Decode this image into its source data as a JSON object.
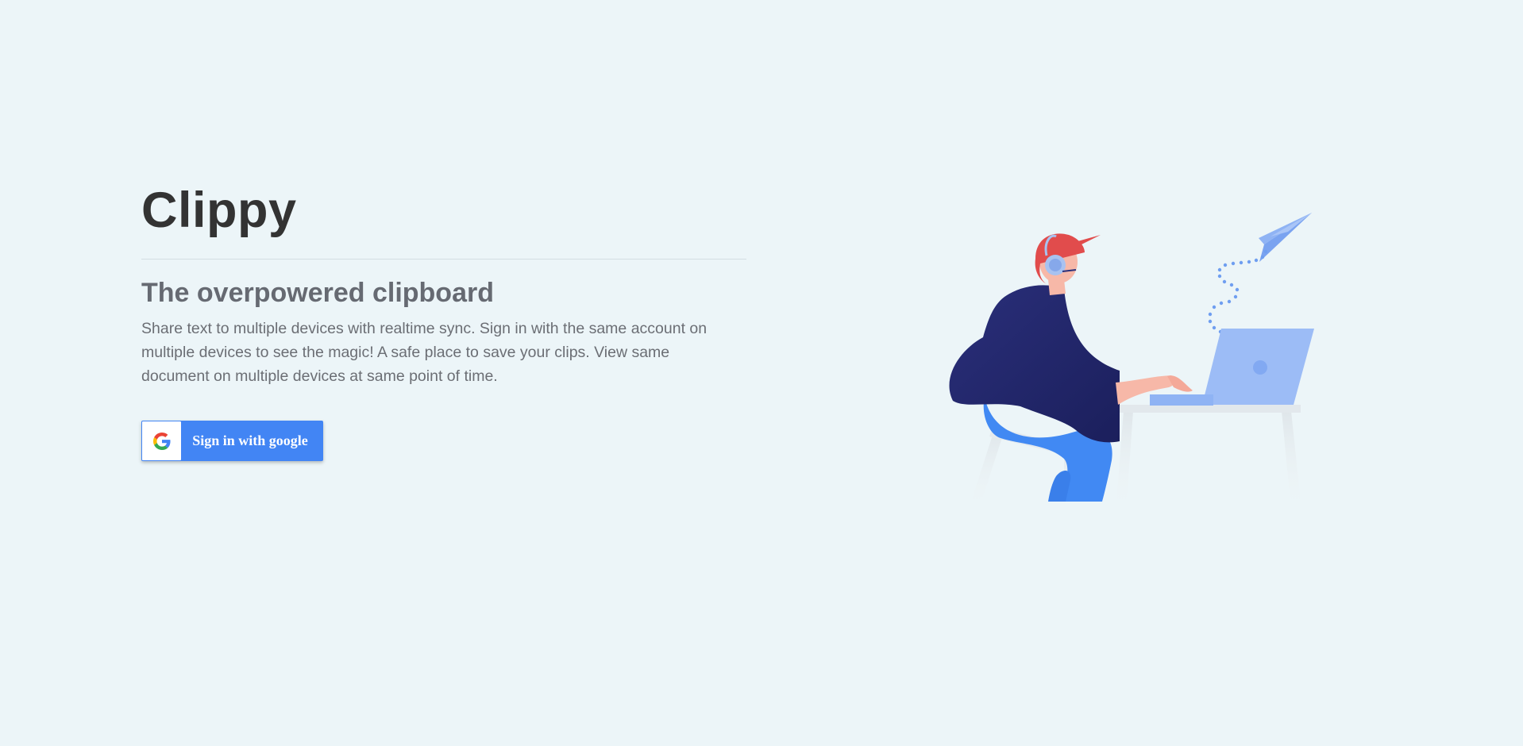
{
  "app": {
    "title": "Clippy"
  },
  "hero": {
    "subtitle": "The overpowered clipboard",
    "description": "Share text to multiple devices with realtime sync. Sign in with the same account on multiple devices to see the magic! A safe place to save your clips. View same document on multiple devices at same point of time."
  },
  "signin": {
    "label": "Sign in with google",
    "icon": "google-icon"
  },
  "colors": {
    "background": "#ecf5f8",
    "button": "#4285f4",
    "title": "#333333",
    "subtitle": "#666a72"
  }
}
